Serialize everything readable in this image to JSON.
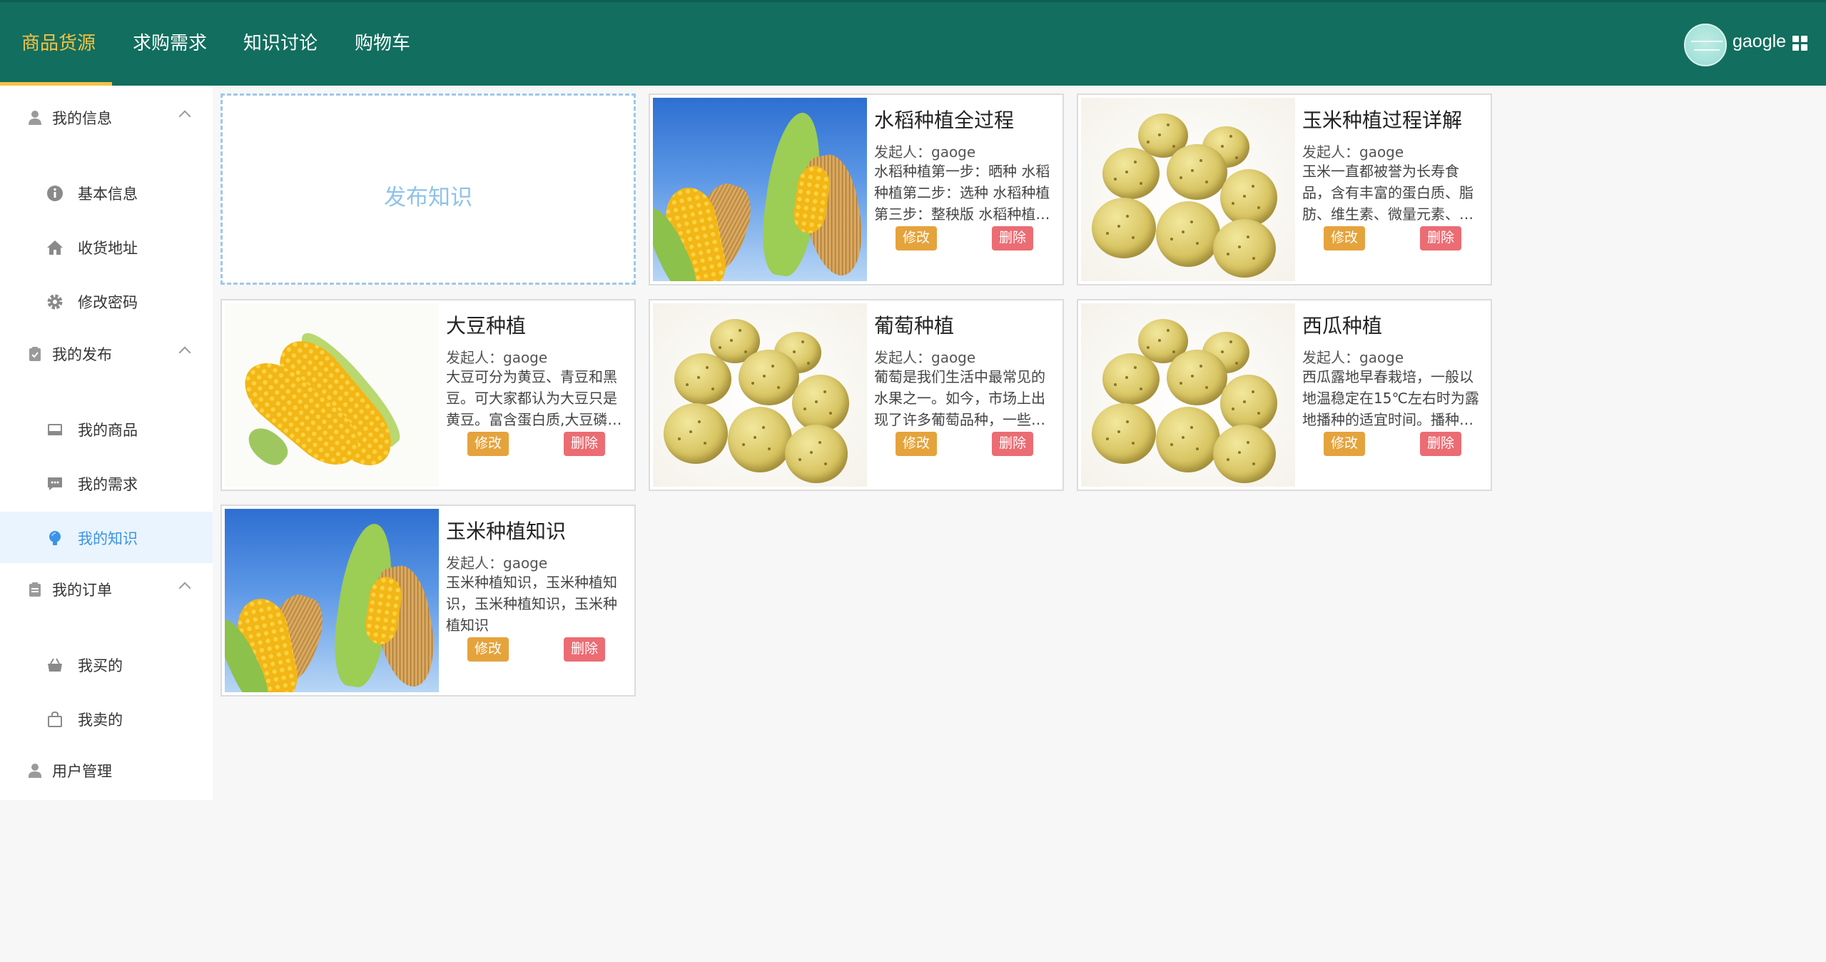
{
  "nav": {
    "items": [
      {
        "label": "商品货源",
        "active": true
      },
      {
        "label": "求购需求",
        "active": false
      },
      {
        "label": "知识讨论",
        "active": false
      },
      {
        "label": "购物车",
        "active": false
      }
    ],
    "username": "gaogle",
    "colors": {
      "bar": "#126e5e",
      "active": "#f5c243"
    }
  },
  "sidebar": {
    "groups": [
      {
        "label": "我的信息",
        "icon": "user-icon",
        "items": [
          {
            "label": "基本信息",
            "icon": "info-icon"
          },
          {
            "label": "收货地址",
            "icon": "home-icon"
          },
          {
            "label": "修改密码",
            "icon": "gear-icon"
          }
        ]
      },
      {
        "label": "我的发布",
        "icon": "clipboard-check-icon",
        "items": [
          {
            "label": "我的商品",
            "icon": "inbox-icon"
          },
          {
            "label": "我的需求",
            "icon": "chat-icon"
          },
          {
            "label": "我的知识",
            "icon": "bulb-icon",
            "active": true
          }
        ]
      },
      {
        "label": "我的订单",
        "icon": "clipboard-icon",
        "items": [
          {
            "label": "我买的",
            "icon": "basket-icon"
          },
          {
            "label": "我卖的",
            "icon": "bag-icon"
          }
        ]
      },
      {
        "label": "用户管理",
        "icon": "user-manage-icon",
        "items": []
      }
    ]
  },
  "publish": {
    "label": "发布知识"
  },
  "buttons": {
    "edit": "修改",
    "delete": "删除"
  },
  "cards": [
    {
      "title": "水稻种植全过程",
      "author": "发起人：gaoge",
      "desc": "水稻种植第一步：晒种 水稻种植第二步：选种 水稻种植第三步：整秧版 水稻种植…",
      "image": "corn-sky"
    },
    {
      "title": "玉米种植过程详解",
      "author": "发起人：gaoge",
      "desc": "玉米一直都被誉为长寿食品，含有丰富的蛋白质、脂肪、维生素、微量元素、…",
      "image": "potatoes"
    },
    {
      "title": "大豆种植",
      "author": "发起人：gaoge",
      "desc": "大豆可分为黄豆、青豆和黑豆。可大家都认为大豆只是黄豆。富含蛋白质,大豆磷…",
      "image": "corn-white"
    },
    {
      "title": "葡萄种植",
      "author": "发起人：gaoge",
      "desc": "葡萄是我们生活中最常见的水果之一。如今，市场上出现了许多葡萄品种，一些…",
      "image": "potatoes"
    },
    {
      "title": "西瓜种植",
      "author": "发起人：gaoge",
      "desc": "西瓜露地早春栽培，一般以地温稳定在15℃左右时为露地播种的适宜时间。播种…",
      "image": "potatoes"
    },
    {
      "title": "玉米种植知识",
      "author": "发起人：gaoge",
      "desc": "玉米种植知识，玉米种植知识，玉米种植知识，玉米种植知识",
      "image": "corn-sky"
    }
  ]
}
